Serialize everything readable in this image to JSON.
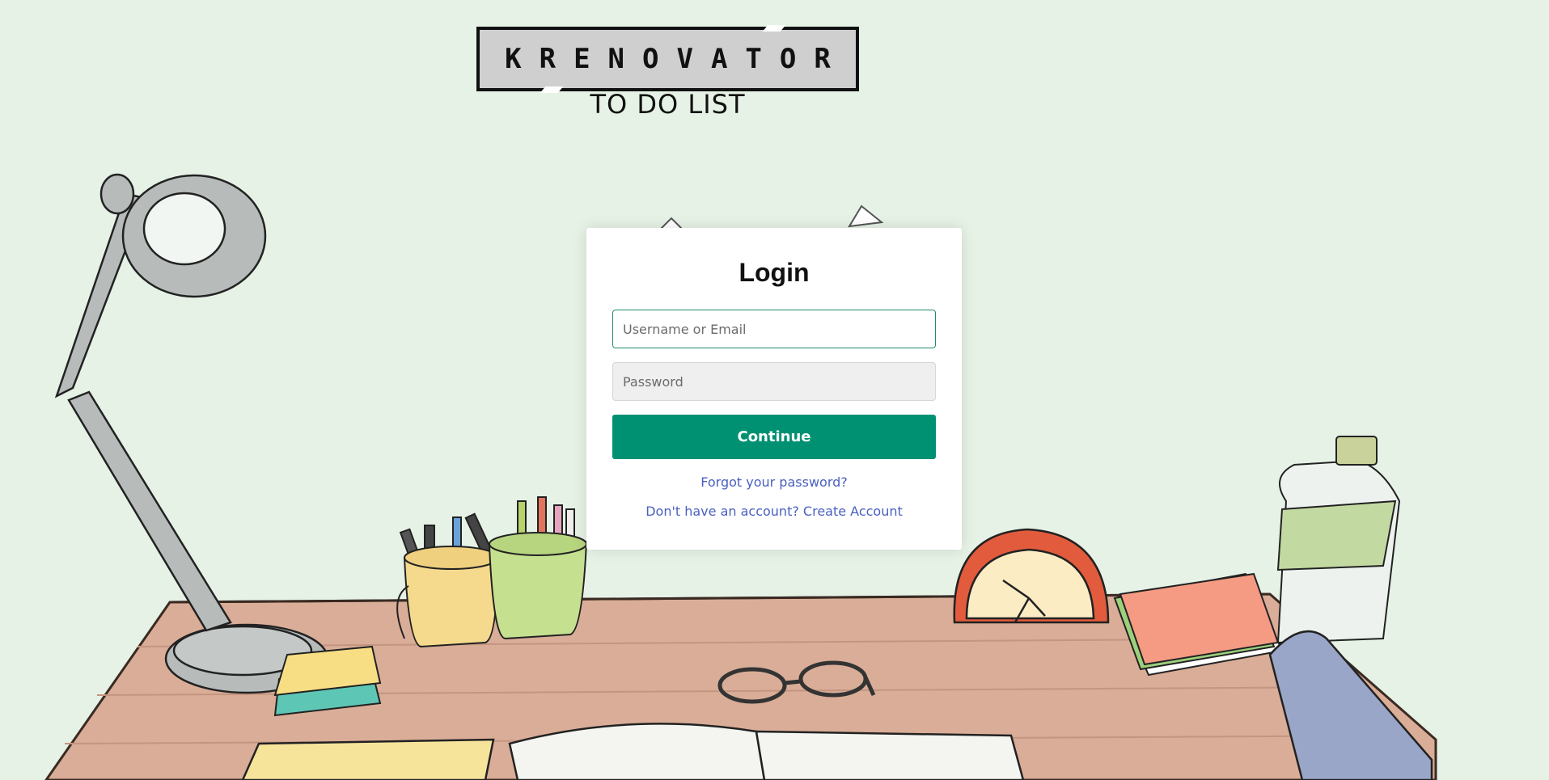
{
  "header": {
    "logo_text": "KRENOVATOR",
    "subtitle": "TO DO LIST"
  },
  "login": {
    "title": "Login",
    "username_placeholder": "Username or Email",
    "username_value": "",
    "password_placeholder": "Password",
    "password_value": "",
    "continue_label": "Continue",
    "forgot_link": "Forgot your password?",
    "create_account_link": "Don't have an account? Create Account"
  },
  "colors": {
    "background": "#e6f2e6",
    "accent": "#009172",
    "link": "#4a5fc1",
    "desk": "#d9ad97"
  }
}
